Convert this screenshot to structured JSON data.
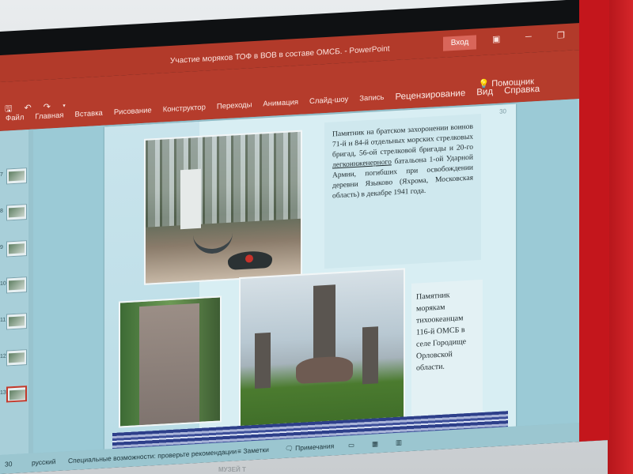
{
  "app": {
    "doc_title": "Участие моряков ТОФ в ВОВ в составе ОМСБ.  -  PowerPoint",
    "login_label": "Вход",
    "helper_label": "Помощник"
  },
  "ribbon": {
    "tabs": [
      {
        "label": "Файл",
        "big": false
      },
      {
        "label": "Главная",
        "big": false
      },
      {
        "label": "Вставка",
        "big": false
      },
      {
        "label": "Рисование",
        "big": false
      },
      {
        "label": "Конструктор",
        "big": false
      },
      {
        "label": "Переходы",
        "big": false
      },
      {
        "label": "Анимация",
        "big": false
      },
      {
        "label": "Слайд-шоу",
        "big": false
      },
      {
        "label": "Запись",
        "big": false
      },
      {
        "label": "Рецензирование",
        "big": true
      },
      {
        "label": "Вид",
        "big": true
      },
      {
        "label": "Справка",
        "big": true
      }
    ]
  },
  "slide": {
    "number": "30",
    "text1_a": "Памятник на братском захоронении воинов 71-й и 84-й отдельных морских стрелковых бригад, 56-ой стрелковой бригады и 20-го ",
    "text1_link": "легкоинженерного",
    "text1_b": " батальона 1-ой Ударной Армии, погибших при освобождении деревни Языково (Яхрома, Московская область) в декабре 1941 года.",
    "text2": "Памятник морякам тихоокеанцам 116-й ОМСБ в селе Городище Орловской области."
  },
  "thumbnails": [
    {
      "num": "7"
    },
    {
      "num": "8"
    },
    {
      "num": "9"
    },
    {
      "num": "10"
    },
    {
      "num": "11"
    },
    {
      "num": "12"
    },
    {
      "num": "13"
    }
  ],
  "statusbar": {
    "slide_info": "30",
    "language": "русский",
    "accessibility": "Специальные возможности: проверьте рекомендации",
    "notes_label": "Заметки",
    "comments_label": "Примечания"
  },
  "bezel_label": "МУЗЕЙ Т"
}
